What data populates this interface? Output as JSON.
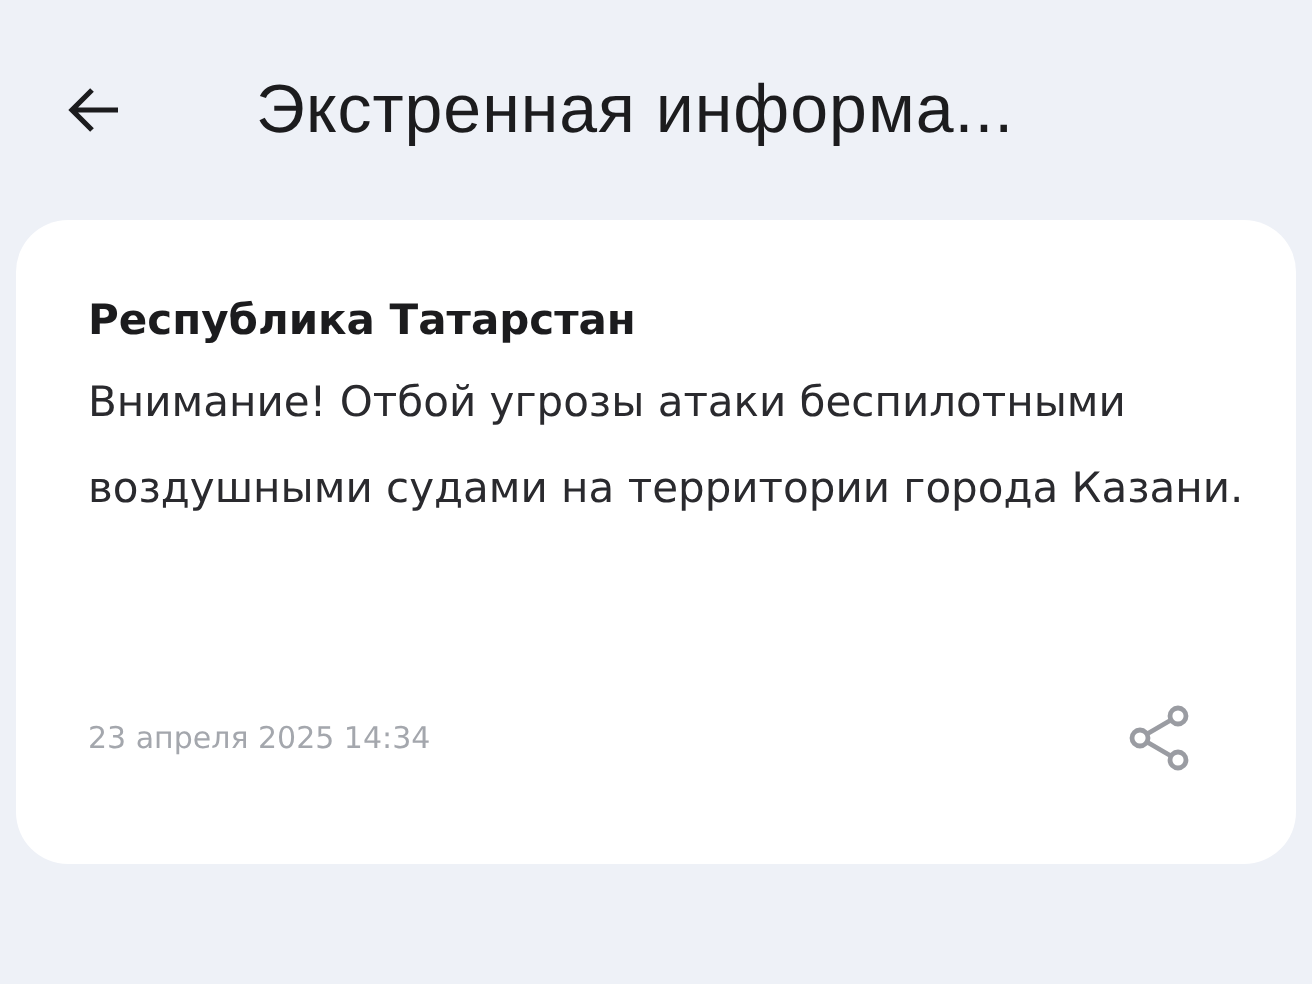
{
  "header": {
    "title": "Экстренная информа..."
  },
  "card": {
    "source": "Республика Татарстан",
    "message": "Внимание! Отбой угрозы атаки беспилотными воздушными судами на территории города Казани.",
    "date": "23 апреля 2025 14:34"
  }
}
